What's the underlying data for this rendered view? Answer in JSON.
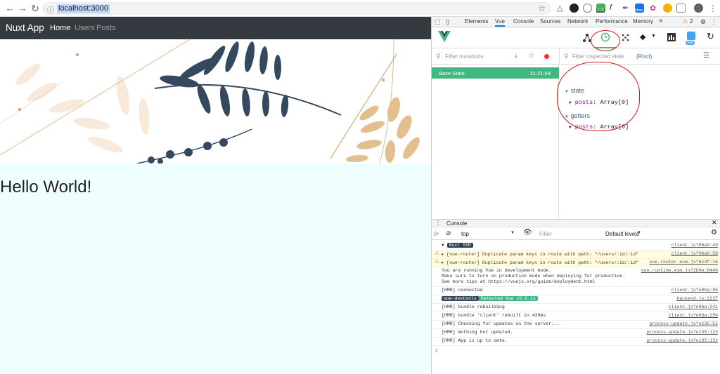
{
  "browser": {
    "url": "localhost:3000",
    "badge_count": "208",
    "new_label": "New"
  },
  "page": {
    "brand": "Nuxt App",
    "nav": [
      "Home",
      "Users",
      "Posts"
    ],
    "heading": "Hello World!"
  },
  "devtools": {
    "tabs": [
      "Elements",
      "Vue",
      "Console",
      "Sources",
      "Network",
      "Performance",
      "Memory"
    ],
    "more": "»",
    "warnings": "2",
    "vue_new_label": "new",
    "filter_mutations": "Filter mutations",
    "filter_inspected": "Filter inspected state",
    "root_label": "(Root)",
    "base_state": "Base State",
    "base_time": "21:21:54",
    "state_label": "state",
    "getters_label": "getters",
    "prop_key": "posts",
    "prop_value": "Array[0]"
  },
  "console": {
    "title": "Console",
    "context": "top",
    "filter": "Filter",
    "levels": "Default levels",
    "lines": [
      {
        "type": "badge",
        "badge": "Nuxt SSR",
        "text": "",
        "src": "client.js?06a0:49"
      },
      {
        "type": "warn",
        "badge": "",
        "text": "▸ [vue-router] Duplicate param keys in route with path: \"/users/:id/:id\"",
        "src": "client.js?06a0:50"
      },
      {
        "type": "warn",
        "badge": "",
        "text": "▸ [vue-router] Duplicate param keys in route with path: \"/users/:id/:id\"",
        "src": "vue-router.esm.js?8c4f:16"
      },
      {
        "type": "multi",
        "badge": "",
        "text": "You are running Vue in development mode.",
        "text2": "Make sure to turn on production mode when deploying for production.",
        "text3": "See more tips at https://vuejs.org/guide/deployment.html",
        "src": "vue.runtime.esm.js?2b0e:8440"
      },
      {
        "type": "log",
        "badge": "",
        "text": "[HMR] connected",
        "src": "client.js?e0ba:95"
      },
      {
        "type": "devtools",
        "badge": "vue-devtools",
        "badge2": "Detected Vue v2.6.11",
        "text": "",
        "src": "backend.js:2237"
      },
      {
        "type": "log",
        "badge": "",
        "text": "[HMR] bundle rebuilding",
        "src": "client.js?e0ba:241"
      },
      {
        "type": "log",
        "badge": "",
        "text": "[HMR] bundle 'client' rebuilt in 439ms",
        "src": "client.js?e0ba:250"
      },
      {
        "type": "log",
        "badge": "",
        "text": "[HMR] Checking for updates on the server...",
        "src": "process-update.js?e135:51"
      },
      {
        "type": "log",
        "badge": "",
        "text": "[HMR] Nothing hot updated.",
        "src": "process-update.js?e135:123"
      },
      {
        "type": "log",
        "badge": "",
        "text": "[HMR] App is up to date.",
        "src": "process-update.js?e135:132"
      }
    ],
    "prompt": "›"
  },
  "colors": {
    "vue_green": "#41b883",
    "navbar": "#343a40",
    "annotation_red": "#d21a1a",
    "leaf_navy": "#34495e",
    "leaf_tan": "#e3bf8d"
  }
}
